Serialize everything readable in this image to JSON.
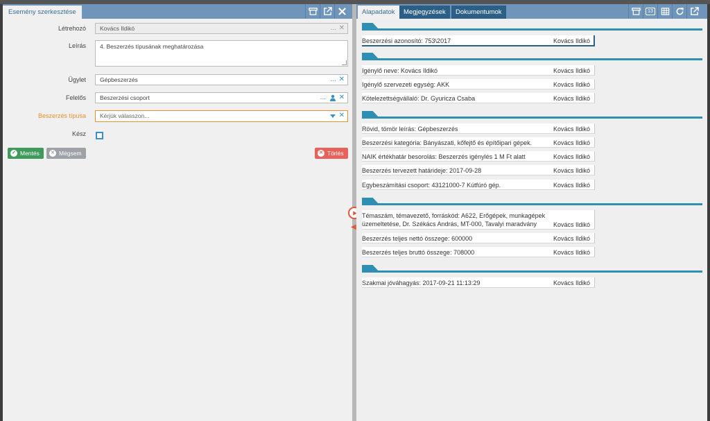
{
  "left": {
    "tab_title": "Esemény szerkesztése",
    "header_icons": [
      "archive-icon",
      "external-link-icon",
      "close-icon"
    ],
    "fields": {
      "letrehozo": {
        "label": "Létrehozó",
        "value": "Kovács Ildikó"
      },
      "leiras": {
        "label": "Leírás",
        "value": "4. Beszerzés típusának meghatározása"
      },
      "ugylet": {
        "label": "Ügylet",
        "value": "Gépbeszerzés"
      },
      "felelos": {
        "label": "Felelős",
        "value": "Beszerzési csoport"
      },
      "beszerzes_tipusa": {
        "label": "Beszerzés típusa",
        "placeholder": "Kérjük válasszon..."
      },
      "kesz": {
        "label": "Kész"
      }
    },
    "buttons": {
      "save": "Mentés",
      "cancel": "Mégsem",
      "delete": "Törlés"
    },
    "ellipsis": "...",
    "colors": {
      "accent": "#6f96ba",
      "warn": "#e8912f",
      "save": "#3f9a5c",
      "delete": "#e9625a"
    }
  },
  "right": {
    "tabs": [
      "Alapadatok",
      "Megjegyzések",
      "Dokumentumok"
    ],
    "header_icons": [
      "archive-icon",
      "badge-icon",
      "grid-icon",
      "refresh-icon",
      "external-link-icon"
    ],
    "badge": "13",
    "sections": [
      {
        "rows": [
          {
            "text": "Beszerzési azonosító: 753\\2017",
            "user": "Kovács Ildikó"
          }
        ]
      },
      {
        "rows": [
          {
            "text": "Igénylő neve: Kovács Ildikó",
            "user": "Kovács Ildikó"
          },
          {
            "text": "Igénylő szervezeti egység: AKK",
            "user": "Kovács Ildikó"
          },
          {
            "text": "Kötelezettségvállaló: Dr. Gyuricza Csaba",
            "user": "Kovács Ildikó"
          }
        ]
      },
      {
        "rows": [
          {
            "text": "Rövid, tömör leírás: Gépbeszerzés",
            "user": "Kovács Ildikó"
          },
          {
            "text": "Beszerzési kategória: Bányászati, kőfejtő és építőipari gépek.",
            "user": "Kovács Ildikó"
          },
          {
            "text": "NAIK értékhatár besorolás: Beszerzés igénylés 1 M Ft alatt",
            "user": "Kovács Ildikó"
          },
          {
            "text": "Beszerzés tervezett határideje: 2017-09-28",
            "user": "Kovács Ildikó"
          },
          {
            "text": "Egybeszámítási csoport: 43121000-7 Kútfúró gép.",
            "user": "Kovács Ildikó"
          }
        ]
      },
      {
        "rows": [
          {
            "text": "Témaszám, témavezető, forráskód: A622, Erőgépek, munkagépek üzemeltetése, Dr. Székács András, MT-000, Tavalyi maradvány",
            "user": "Kovács Ildikó"
          },
          {
            "text": "Beszerzés teljes nettó összege: 600000",
            "user": "Kovács Ildikó"
          },
          {
            "text": "Beszerzés teljes bruttó összege: 708000",
            "user": "Kovács Ildikó"
          }
        ]
      },
      {
        "rows": [
          {
            "text": "Szakmai jóváhagyás: 2017-09-21 11:13:29",
            "user": "Kovács Ildikó"
          }
        ]
      }
    ]
  }
}
